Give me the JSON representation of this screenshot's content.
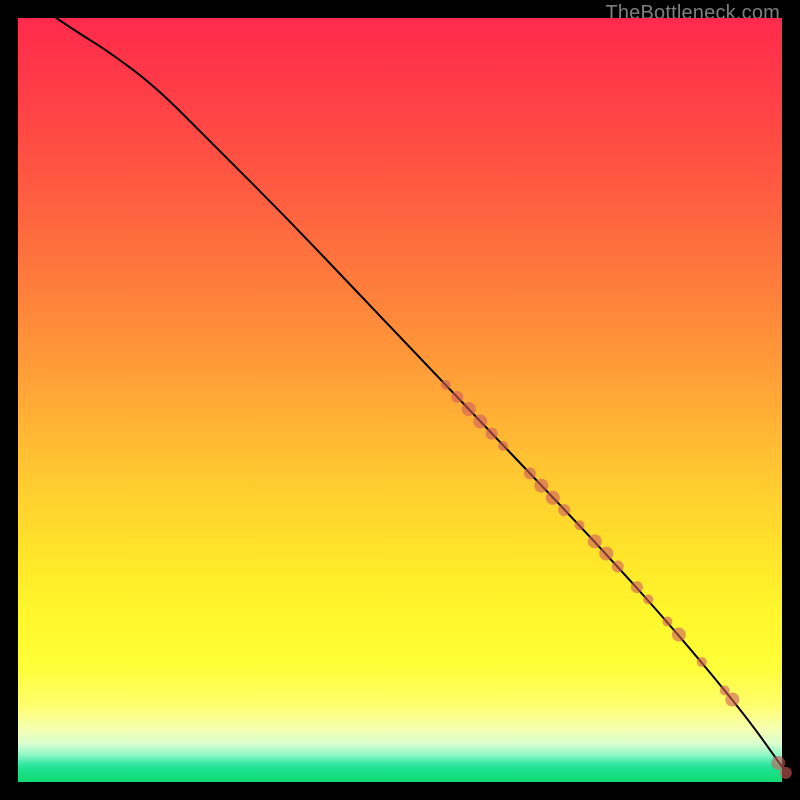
{
  "watermark": "TheBottleneck.com",
  "colors": {
    "dot": "#cf5b5b",
    "curve": "#000000",
    "frame": "#000000"
  },
  "chart_data": {
    "type": "line",
    "title": "",
    "xlabel": "",
    "ylabel": "",
    "xlim": [
      0,
      100
    ],
    "ylim": [
      0,
      100
    ],
    "grid": false,
    "series": [
      {
        "name": "curve",
        "x": [
          5,
          8,
          12,
          18,
          25,
          35,
          45,
          55,
          65,
          75,
          85,
          95,
          100
        ],
        "y": [
          100,
          98,
          95.5,
          91,
          84,
          74,
          63.5,
          53,
          42.5,
          32,
          21,
          9,
          2
        ]
      }
    ],
    "points": [
      {
        "x": 56,
        "y": 52,
        "r": 5
      },
      {
        "x": 57.5,
        "y": 50.4,
        "r": 6
      },
      {
        "x": 59,
        "y": 48.8,
        "r": 7
      },
      {
        "x": 60.5,
        "y": 47.2,
        "r": 7
      },
      {
        "x": 62,
        "y": 45.6,
        "r": 6
      },
      {
        "x": 63.5,
        "y": 44,
        "r": 5
      },
      {
        "x": 67,
        "y": 40.4,
        "r": 6
      },
      {
        "x": 68.5,
        "y": 38.8,
        "r": 7
      },
      {
        "x": 70,
        "y": 37.2,
        "r": 7
      },
      {
        "x": 71.5,
        "y": 35.6,
        "r": 6
      },
      {
        "x": 73.5,
        "y": 33.6,
        "r": 5
      },
      {
        "x": 75.5,
        "y": 31.5,
        "r": 7
      },
      {
        "x": 77,
        "y": 29.9,
        "r": 7
      },
      {
        "x": 78.5,
        "y": 28.2,
        "r": 6
      },
      {
        "x": 81,
        "y": 25.5,
        "r": 6
      },
      {
        "x": 82.5,
        "y": 23.9,
        "r": 5
      },
      {
        "x": 85,
        "y": 21,
        "r": 5
      },
      {
        "x": 86.5,
        "y": 19.3,
        "r": 7
      },
      {
        "x": 89.5,
        "y": 15.7,
        "r": 5
      },
      {
        "x": 92.5,
        "y": 12,
        "r": 5
      },
      {
        "x": 93.5,
        "y": 10.8,
        "r": 7
      },
      {
        "x": 99.5,
        "y": 2.5,
        "r": 7
      },
      {
        "x": 100.5,
        "y": 1.2,
        "r": 6
      }
    ]
  }
}
